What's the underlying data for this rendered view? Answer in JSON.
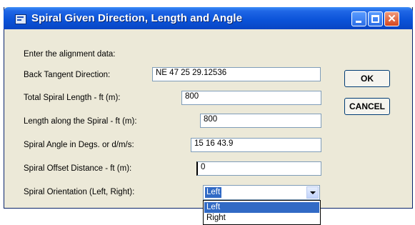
{
  "window": {
    "title": "Spiral Given Direction, Length and Angle",
    "icons": {
      "app": "dialog-app-icon",
      "minimize": "minimize-icon",
      "maximize": "maximize-icon",
      "close": "close-icon"
    },
    "close_glyph": "✕",
    "colors": {
      "titlebar": "#0a52d8",
      "face": "#ece9d8",
      "selection": "#316ac5"
    }
  },
  "form": {
    "intro": "Enter the alignment data:",
    "fields": [
      {
        "label": "Back Tangent Direction:",
        "value": "NE 47 25 29.12536"
      },
      {
        "label": "Total Spiral Length - ft (m):",
        "value": "800"
      },
      {
        "label": "Length along the Spiral - ft (m):",
        "value": "800"
      },
      {
        "label": "Spiral Angle in Degs. or d/m/s:",
        "value": "15 16 43.9"
      },
      {
        "label": "Spiral Offset Distance - ft (m):",
        "value": "0"
      }
    ],
    "orientation": {
      "label": "Spiral Orientation (Left, Right):",
      "selected": "Left",
      "options": [
        "Left",
        "Right"
      ]
    }
  },
  "buttons": {
    "ok": "OK",
    "cancel": "CANCEL"
  }
}
